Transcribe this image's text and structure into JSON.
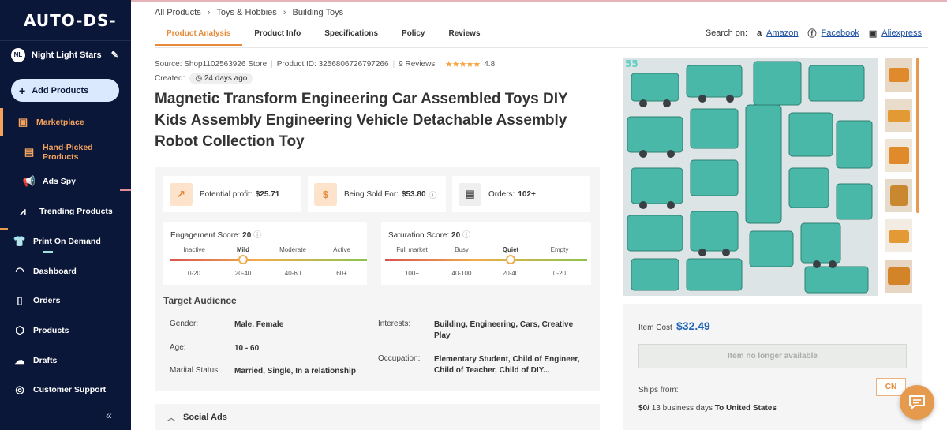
{
  "sidebar": {
    "logo": "AUTO-DS-",
    "user": {
      "initials": "NL",
      "name": "Night Light Stars"
    },
    "add_products": "Add Products",
    "items": [
      {
        "label": "Marketplace",
        "icon": "store-icon"
      },
      {
        "label": "Hand-Picked Products",
        "icon": "box-icon"
      },
      {
        "label": "Ads Spy",
        "icon": "megaphone-icon"
      },
      {
        "label": "Trending Products",
        "icon": "trend-icon"
      },
      {
        "label": "Print On Demand",
        "icon": "shirt-icon"
      },
      {
        "label": "Dashboard",
        "icon": "gauge-icon"
      },
      {
        "label": "Orders",
        "icon": "receipt-icon"
      },
      {
        "label": "Products",
        "icon": "cube-icon"
      },
      {
        "label": "Drafts",
        "icon": "cloud-upload-icon"
      },
      {
        "label": "Customer Support",
        "icon": "headset-icon"
      }
    ],
    "collapse": "«"
  },
  "breadcrumb": [
    "All Products",
    "Toys & Hobbies",
    "Building Toys"
  ],
  "tabs": [
    "Product Analysis",
    "Product Info",
    "Specifications",
    "Policy",
    "Reviews"
  ],
  "search_on": {
    "label": "Search on:",
    "links": [
      "Amazon",
      "Facebook",
      "Aliexpress"
    ]
  },
  "meta": {
    "source": "Source: Shop1102563926 Store",
    "product_id": "Product ID: 3256806726797266",
    "reviews": "9 Reviews",
    "stars": "★★★★★",
    "rating": "4.8",
    "created_label": "Created:",
    "created_value": "24 days ago"
  },
  "title": "Magnetic Transform Engineering Car Assembled Toys DIY Kids Assembly Engineering Vehicle Detachable Assembly Robot Collection Toy",
  "stats": {
    "profit_label": "Potential profit:",
    "profit_value": "$25.71",
    "sold_label": "Being Sold For:",
    "sold_value": "$53.80",
    "orders_label": "Orders:",
    "orders_value": "102+"
  },
  "engagement": {
    "label": "Engagement Score:",
    "value": "20",
    "levels": [
      "Inactive",
      "Mild",
      "Moderate",
      "Active"
    ],
    "ranges": [
      "0-20",
      "20-40",
      "40-60",
      "60+"
    ]
  },
  "saturation": {
    "label": "Saturation Score:",
    "value": "20",
    "levels": [
      "Full market",
      "Busy",
      "Quiet",
      "Empty"
    ],
    "ranges": [
      "100+",
      "40-100",
      "20-40",
      "0-20"
    ]
  },
  "audience": {
    "title": "Target Audience",
    "gender_label": "Gender:",
    "gender": "Male, Female",
    "age_label": "Age:",
    "age": "10 - 60",
    "marital_label": "Marital Status:",
    "marital": "Married, Single, In a relationship",
    "interests_label": "Interests:",
    "interests": "Building, Engineering, Cars, Creative Play",
    "occupation_label": "Occupation:",
    "occupation": "Elementary Student, Child of Engineer, Child of Teacher, Child of DIY..."
  },
  "social_ads": "Social Ads",
  "right": {
    "item_cost_label": "Item Cost",
    "item_cost": "$32.49",
    "unavailable": "Item no longer available",
    "ships_from": "Ships from:",
    "country": "CN",
    "ship_price": "$0/",
    "ship_days": "13 business days",
    "ship_to": "To United States"
  },
  "colors": {
    "sidebar_bg": "#0b1739",
    "accent": "#e58b3a",
    "price_blue": "#1f63b6",
    "link_blue": "#1d4fa4"
  }
}
